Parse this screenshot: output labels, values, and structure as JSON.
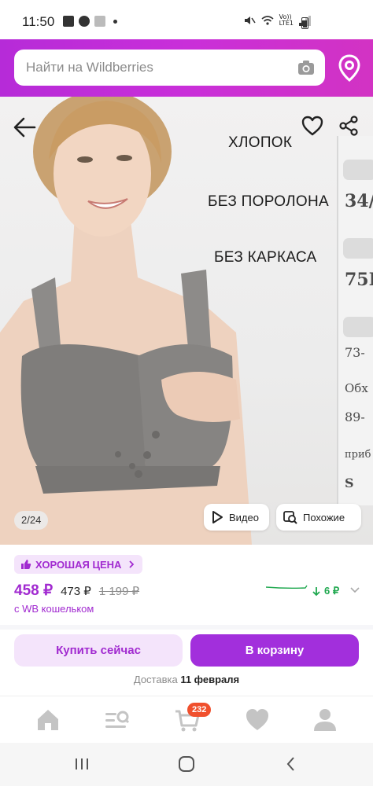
{
  "status_bar": {
    "time": "11:50",
    "network_label_top": "Vo))",
    "network_label_bottom": "LTE1",
    "signal_label": "6"
  },
  "header": {
    "search_placeholder": "Найти на Wildberries",
    "accent_color": "#cb30d8"
  },
  "product": {
    "promo_lines": [
      "ХЛОПОК",
      "БЕЗ ПОРОЛОНА",
      "БЕЗ КАРКАСА"
    ],
    "size_values": [
      "34/",
      "75I",
      "73-",
      "Обх",
      "89-",
      "приб",
      "S"
    ],
    "photo_counter": "2/24",
    "video_label": "Видео",
    "similar_label": "Похожие"
  },
  "pricing": {
    "badge_label": "ХОРОШАЯ ЦЕНА",
    "price_wallet": "458 ₽",
    "price_regular": "473 ₽",
    "price_old": "1 199 ₽",
    "wallet_note": "с WB кошельком",
    "trend_value": "6 ₽",
    "trend_color": "#1fa84f",
    "price_color": "#a12ad0"
  },
  "actions": {
    "buy_now_label": "Купить сейчас",
    "add_to_cart_label": "В корзину",
    "delivery_prefix": "Доставка",
    "delivery_date": "11 февраля"
  },
  "tabbar": {
    "icons": [
      "home-icon",
      "catalog-search-icon",
      "cart-icon",
      "heart-icon",
      "profile-icon"
    ],
    "cart_count": "232"
  }
}
